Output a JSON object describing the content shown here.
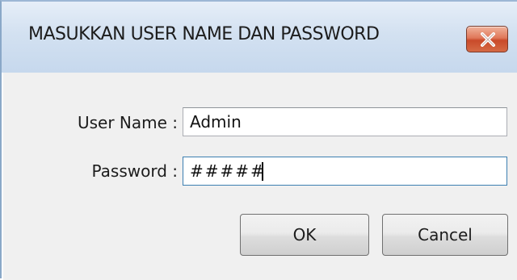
{
  "window": {
    "title": "MASUKKAN USER NAME DAN PASSWORD",
    "close_icon": "close-icon",
    "accent_color": "#d56a45"
  },
  "form": {
    "username_label": "User Name :",
    "username_value": "Admin",
    "password_label": "Password :",
    "password_value": "#####"
  },
  "buttons": {
    "ok_label": "OK",
    "cancel_label": "Cancel"
  }
}
